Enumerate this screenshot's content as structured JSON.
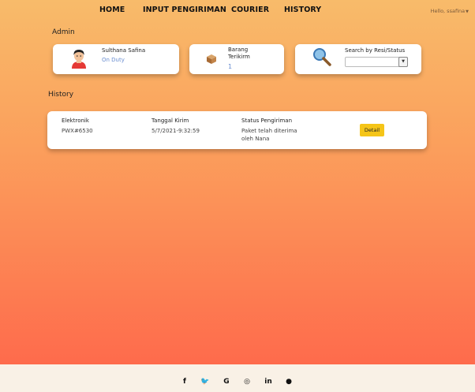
{
  "nav": {
    "items": [
      {
        "label": "HOME"
      },
      {
        "label": "INPUT PENGIRIMAN"
      },
      {
        "label": "COURIER"
      },
      {
        "label": "HISTORY"
      }
    ],
    "user_greeting": "Hello, ssafina"
  },
  "admin": {
    "section_title": "Admin",
    "profile": {
      "name": "Sulthana Safina",
      "status": "On Duty",
      "icon": "person-avatar-icon"
    },
    "delivered": {
      "label_line1": "Barang",
      "label_line2": "Terikirm",
      "count": "1",
      "icon": "package-box-icon"
    },
    "search": {
      "label": "Search by Resi/Status",
      "value": "",
      "icon": "magnifier-icon"
    }
  },
  "history": {
    "section_title": "History",
    "columns": [
      "Elektronik",
      "Tanggal Kirim",
      "Status Pengiriman"
    ],
    "rows": [
      {
        "resi": "PWX#6530",
        "date": "5/7/2021-9:32:59",
        "status_line1": "Paket telah diterima",
        "status_line2": "oleh Nana",
        "action": "Detail"
      }
    ]
  },
  "footer": {
    "social_icons": [
      {
        "name": "facebook-icon",
        "glyph": "f"
      },
      {
        "name": "twitter-icon",
        "glyph": "🐦"
      },
      {
        "name": "google-icon",
        "glyph": "G"
      },
      {
        "name": "instagram-icon",
        "glyph": "◎"
      },
      {
        "name": "linkedin-icon",
        "glyph": "in"
      },
      {
        "name": "github-icon",
        "glyph": "●"
      }
    ]
  },
  "colors": {
    "accent_blue": "#6b8fd1",
    "button_yellow": "#f5c518",
    "gradient_top": "#f8bb6a",
    "gradient_bottom": "#fe6b4c"
  }
}
